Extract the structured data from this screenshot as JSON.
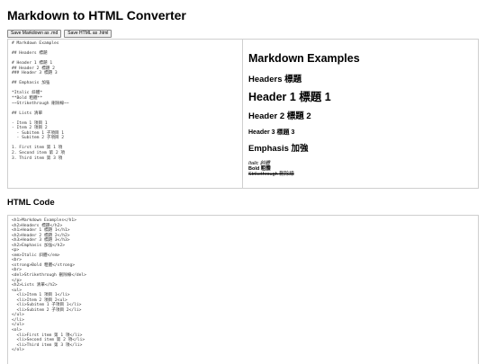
{
  "page": {
    "title": "Markdown to HTML Converter"
  },
  "toolbar": {
    "save_markdown_label": "Save Markdown as .md",
    "save_html_label": "Save HTML as .html"
  },
  "editor": {
    "markdown": "# Markdown Examples\n\n## Headers 標題\n\n# Header 1 標題 1\n## Header 2 標題 2\n### Header 3 標題 3\n\n## Emphasis 加強\n\n*Italic 斜體*\n**Bold 粗體**\n~~Strikethrough 刪除線~~\n\n## Lists 清單\n\n- Item 1 項目 1\n- Item 2 項目 2\n  - Subitem 1 子項目 1\n  - Subitem 2 子項目 2\n\n1. First item 第 1 項\n2. Second item 第 2 項\n3. Third item 第 3 項"
  },
  "preview": {
    "h1": "Markdown Examples",
    "headers_heading": "Headers 標題",
    "header1": "Header 1 標題 1",
    "header2": "Header 2 標題 2",
    "header3": "Header 3 標題 3",
    "emphasis_heading": "Emphasis 加強",
    "italic": "Italic 斜體",
    "bold": "Bold 粗體",
    "strikethrough": "Strikethrough 刪除線"
  },
  "html_section": {
    "heading": "HTML Code",
    "code": "<h1>Markdown Examples</h1>\n<h2>Headers 標題</h2>\n<h1>Header 1 標題 1</h1>\n<h2>Header 2 標題 2</h2>\n<h3>Header 3 標題 3</h3>\n<h2>Emphasis 加強</h2>\n<p>\n<em>Italic 斜體</em>\n<br>\n<strong>Bold 粗體</strong>\n<br>\n<del>Strikethrough 刪除線</del>\n</p>\n<h2>Lists 清單</h2>\n<ul>\n  <li>Item 1 項目 1</li>\n  <li>Item 2 項目 2<ul>\n  <li>Subitem 1 子項目 1</li>\n  <li>Subitem 2 子項目 2</li>\n</ul>\n</li>\n</ul>\n<ol>\n  <li>First item 第 1 項</li>\n  <li>Second item 第 2 項</li>\n  <li>Third item 第 3 項</li>\n</ol>"
  }
}
